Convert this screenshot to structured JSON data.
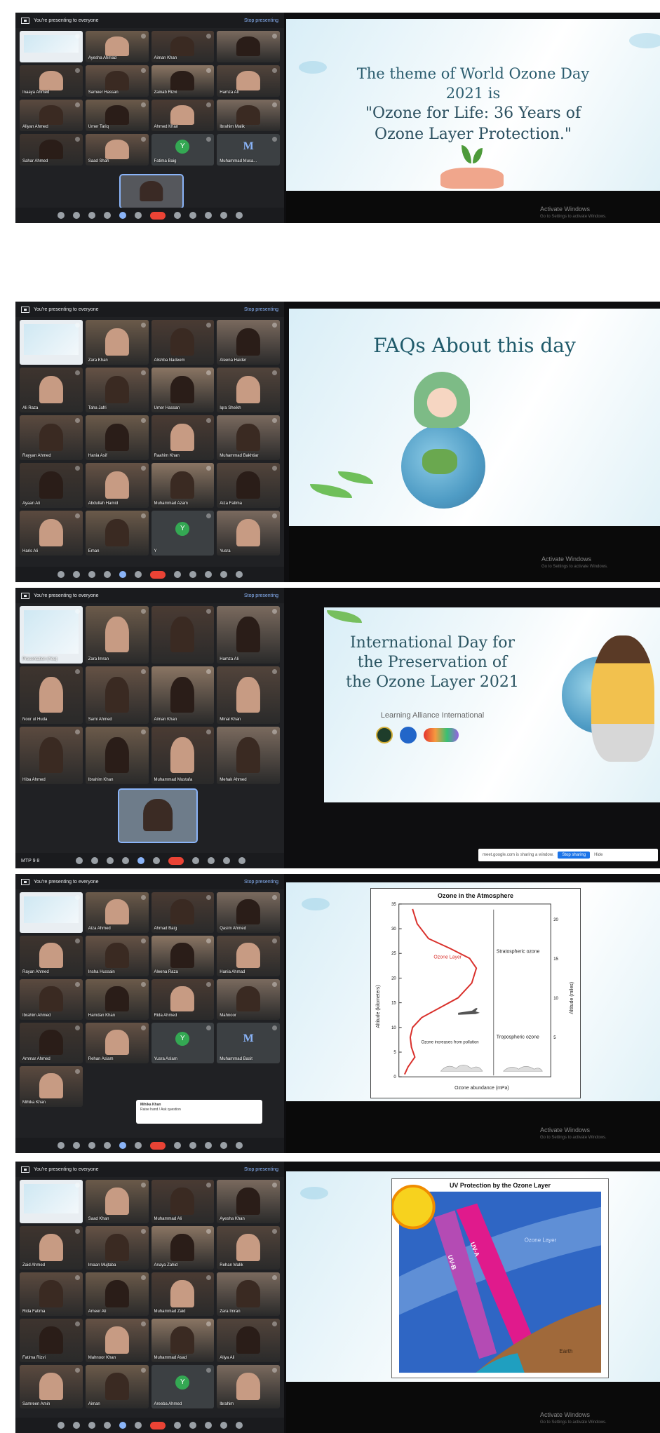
{
  "common": {
    "presenting_label": "You're presenting to everyone",
    "stop_label": "Stop presenting",
    "activate_title": "Activate Windows",
    "activate_sub": "Go to Settings to activate Windows."
  },
  "panel1": {
    "slide_line1": "The theme of World Ozone Day",
    "slide_line2": "2021 is",
    "slide_line3": "\"Ozone for Life: 36 Years of",
    "slide_line4": "Ozone Layer Protection.\"",
    "tiles": [
      "",
      "Ayesha Ahmad",
      "Aiman Khan",
      "",
      "Inaaya Ahmed",
      "Sameer Hassan",
      "Zainab Rizvi",
      "Hamza Ali",
      "Aliyan Ahmed",
      "Umer Tariq",
      "Ahmed Khan",
      "Ibrahim Malik",
      "Sahar Ahmed",
      "Saad Shah",
      "Fatima Baig",
      "Muhammad Musa..."
    ],
    "avatar_y": "Y",
    "avatar_m": "M"
  },
  "panel2": {
    "slide_title": "FAQs About this day",
    "tiles": [
      "",
      "Zara Khan",
      "Alishba Nadeem",
      "Aleena Haider",
      "Ali Raza",
      "Taha Jafri",
      "Umer Hassan",
      "Iqra Sheikh",
      "Rayyan Ahmed",
      "Hania Asif",
      "Raahim Khan",
      "Muhammad Bakhtiar",
      "Ayaan Ali",
      "Abdullah Hamid",
      "Muhammad Azam",
      "Aiza Fatima",
      "Haris Ali",
      "Eman",
      "Y",
      "Yusra"
    ]
  },
  "panel3": {
    "slide_line1": "International Day for",
    "slide_line2": "the Preservation of",
    "slide_line3": "the Ozone Layer 2021",
    "slide_sub": "Learning Alliance International",
    "meeting_code": "MTP 9 8",
    "share_text": "meet.google.com is sharing a window.",
    "share_stop": "Stop sharing",
    "share_hide": "Hide",
    "tiles": [
      "Presentation (You)",
      "Zara Imran",
      "",
      "Hamza Ali",
      "Noor ul Huda",
      "Sami Ahmed",
      "Aiman Khan",
      "Minal Khan",
      "Hiba Ahmed",
      "Ibrahim Khan",
      "Muhammad Mustafa",
      "Mehak Ahmed"
    ]
  },
  "panel4": {
    "chart_title": "Ozone in the Atmosphere",
    "y_left_label": "Altitude (kilometers)",
    "y_right_label": "Altitude (miles)",
    "x_label": "Ozone abundance (mPa)",
    "ozone_layer_label": "Ozone Layer",
    "strat_label": "Stratospheric ozone",
    "tropo_label": "Tropospheric ozone",
    "pollution_label": "Ozone increases from pollution",
    "notif_title": "Mihika Khan",
    "notif_body": "Raise hand / Ask question",
    "tiles": [
      "",
      "Aiza Ahmed",
      "Ahmad Baig",
      "Qasim Ahmed",
      "Rayan Ahmed",
      "Insha Hussain",
      "Aleena Raza",
      "Hania Ahmad",
      "Ibrahim Ahmed",
      "Hamdan Khan",
      "Rida Ahmed",
      "Mahnoor",
      "Ammar Ahmed",
      "Rehan Aslam",
      "Yusra Aslam",
      "Muhammad Basit",
      "Mihika Khan"
    ]
  },
  "panel5": {
    "chart_title": "UV Protection by the Ozone Layer",
    "uvb": "UV-B",
    "uva": "UV-A",
    "ozone_layer": "Ozone Layer",
    "earth": "Earth",
    "tiles": [
      "",
      "Saad Khan",
      "Muhammad Ali",
      "Ayesha Khan",
      "Zaid Ahmed",
      "Imaan Mujtaba",
      "Anaya Zahid",
      "Rehan Malik",
      "Rida Fatima",
      "Ameer Ali",
      "Muhammad Zaid",
      "Zara Imran",
      "Fatima Rizvi",
      "Mahnoor Khan",
      "Muhammad Asad",
      "Aliya Ali",
      "Samreen Amin",
      "Aiman",
      "Areeba Ahmed",
      "Ibrahim"
    ]
  },
  "chart_data": {
    "type": "line",
    "title": "Ozone in the Atmosphere",
    "xlabel": "Ozone abundance (mPa)",
    "ylabel": "Altitude (kilometers)",
    "y2label": "Altitude (miles)",
    "ylim": [
      0,
      35
    ],
    "y2lim": [
      0,
      22
    ],
    "yticks": [
      0,
      5,
      10,
      15,
      20,
      25,
      30,
      35
    ],
    "y2ticks": [
      5,
      10,
      15,
      20
    ],
    "series": [
      {
        "name": "Ozone Layer",
        "x": [
          0.5,
          0.8,
          1.4,
          1.1,
          1.0,
          1.2,
          2.0,
          3.6,
          5.2,
          6.4,
          6.8,
          6.2,
          4.5,
          2.6,
          1.6,
          1.2
        ],
        "y": [
          0.5,
          2,
          4,
          6,
          8,
          10,
          12,
          14,
          16,
          19,
          22,
          24,
          26,
          28,
          31,
          34
        ]
      }
    ]
  }
}
